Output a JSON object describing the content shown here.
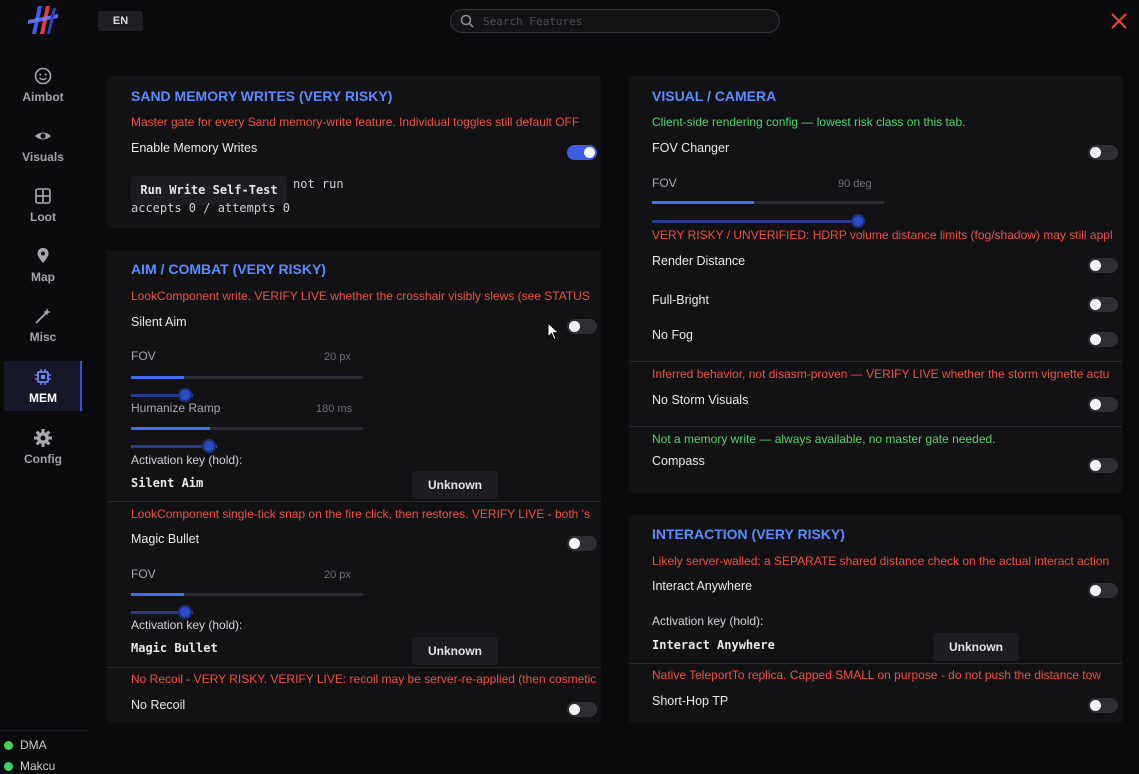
{
  "header": {
    "lang": "EN",
    "search_placeholder": "Search Features"
  },
  "sidebar": {
    "items": [
      {
        "label": "Aimbot"
      },
      {
        "label": "Visuals"
      },
      {
        "label": "Loot"
      },
      {
        "label": "Map"
      },
      {
        "label": "Misc"
      },
      {
        "label": "MEM"
      },
      {
        "label": "Config"
      }
    ],
    "active": "MEM",
    "status": [
      {
        "label": "DMA"
      },
      {
        "label": "Makcu"
      }
    ],
    "status_color": "#3fcf5a"
  },
  "colors": {
    "accent": "#5b8cff",
    "warning": "#f0503e",
    "info": "#4fd66a",
    "toggle_on": "#3c5ee6"
  },
  "sand": {
    "title": "SAND MEMORY WRITES (VERY RISKY)",
    "note": "Master gate for every Sand memory-write feature. Individual toggles still default OFF",
    "enable_label": "Enable Memory Writes",
    "enable_on": true,
    "self_test_button": "Run Write Self-Test",
    "self_test_status": "not run",
    "counter": "accepts 0 / attempts 0"
  },
  "aim": {
    "title": "AIM / COMBAT (VERY RISKY)",
    "silent_note": "LookComponent write. VERIFY LIVE whether the crosshair visibly slews (see STATUS",
    "silent_label": "Silent Aim",
    "silent_on": false,
    "fov_label": "FOV",
    "fov_value": "20 px",
    "fov_fraction": 0.23,
    "ramp_label": "Humanize Ramp",
    "ramp_value": "180 ms",
    "ramp_fraction": 0.34,
    "silent_key_label": "Activation key (hold):",
    "silent_key_name": "Silent Aim",
    "silent_key_value": "Unknown",
    "magic_note": "LookComponent single-tick snap on the fire click, then restores. VERIFY LIVE - both 's",
    "magic_label": "Magic Bullet",
    "magic_on": false,
    "magic_fov_label": "FOV",
    "magic_fov_value": "20 px",
    "magic_fov_fraction": 0.23,
    "magic_key_label": "Activation key (hold):",
    "magic_key_name": "Magic Bullet",
    "magic_key_value": "Unknown",
    "recoil_note": "No Recoil - VERY RISKY. VERIFY LIVE: recoil may be server-re-applied (then cosmetic",
    "recoil_label": "No Recoil",
    "recoil_on": false
  },
  "visual": {
    "title": "VISUAL / CAMERA",
    "client_note": "Client-side rendering config — lowest risk class on this tab.",
    "fov_changer_label": "FOV Changer",
    "fov_changer_on": false,
    "fov_label": "FOV",
    "fov_value": "90 deg",
    "fov_fraction": 0.44,
    "hdrp_note": "VERY RISKY / UNVERIFIED: HDRP volume distance limits (fog/shadow) may still appl",
    "render_label": "Render Distance",
    "render_on": false,
    "fullbright_label": "Full-Bright",
    "fullbright_on": false,
    "nofog_label": "No Fog",
    "nofog_on": false,
    "storm_note": "Inferred behavior, not disasm-proven — VERIFY LIVE whether the storm vignette actu",
    "storm_label": "No Storm Visuals",
    "storm_on": false,
    "compass_note": "Not a memory write — always available, no master gate needed.",
    "compass_label": "Compass",
    "compass_on": false
  },
  "interaction": {
    "title": "INTERACTION (VERY RISKY)",
    "note": "Likely server-walled: a SEPARATE shared distance check on the actual interact action",
    "anywhere_label": "Interact Anywhere",
    "anywhere_on": false,
    "key_label": "Activation key (hold):",
    "key_name": "Interact Anywhere",
    "key_value": "Unknown",
    "tp_note": "Native TeleportTo replica. Capped SMALL on purpose - do not push the distance tow",
    "tp_label": "Short-Hop TP",
    "tp_on": false
  }
}
